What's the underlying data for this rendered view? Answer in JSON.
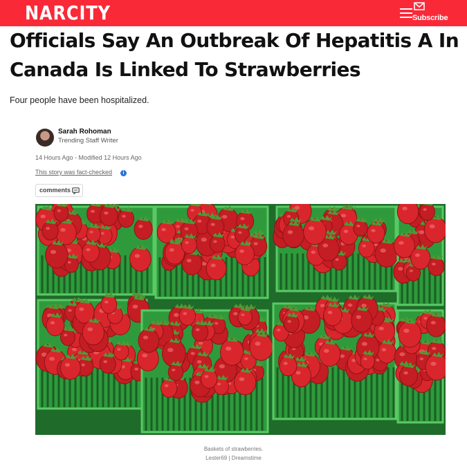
{
  "brand": {
    "logo_text": "NARCITY",
    "bar_color": "#fa2938"
  },
  "header": {
    "menu_icon": "hamburger-icon",
    "subscribe_icon": "envelope-icon",
    "subscribe_label": "Subscribe"
  },
  "article": {
    "headline": "Officials Say An Outbreak Of Hepatitis A In Canada Is Linked To Strawberries",
    "dek": "Four people have been hospitalized.",
    "author": {
      "name": "Sarah Rohoman",
      "role": "Trending Staff Writer"
    },
    "published": "14 Hours Ago",
    "modified": "- Modified 12 Hours Ago",
    "fact_check_text": "This story was fact-checked",
    "comments_label": "comments",
    "image": {
      "caption": "Baskets of strawberries.",
      "credit": "Lester69 | Dreamstime"
    }
  }
}
